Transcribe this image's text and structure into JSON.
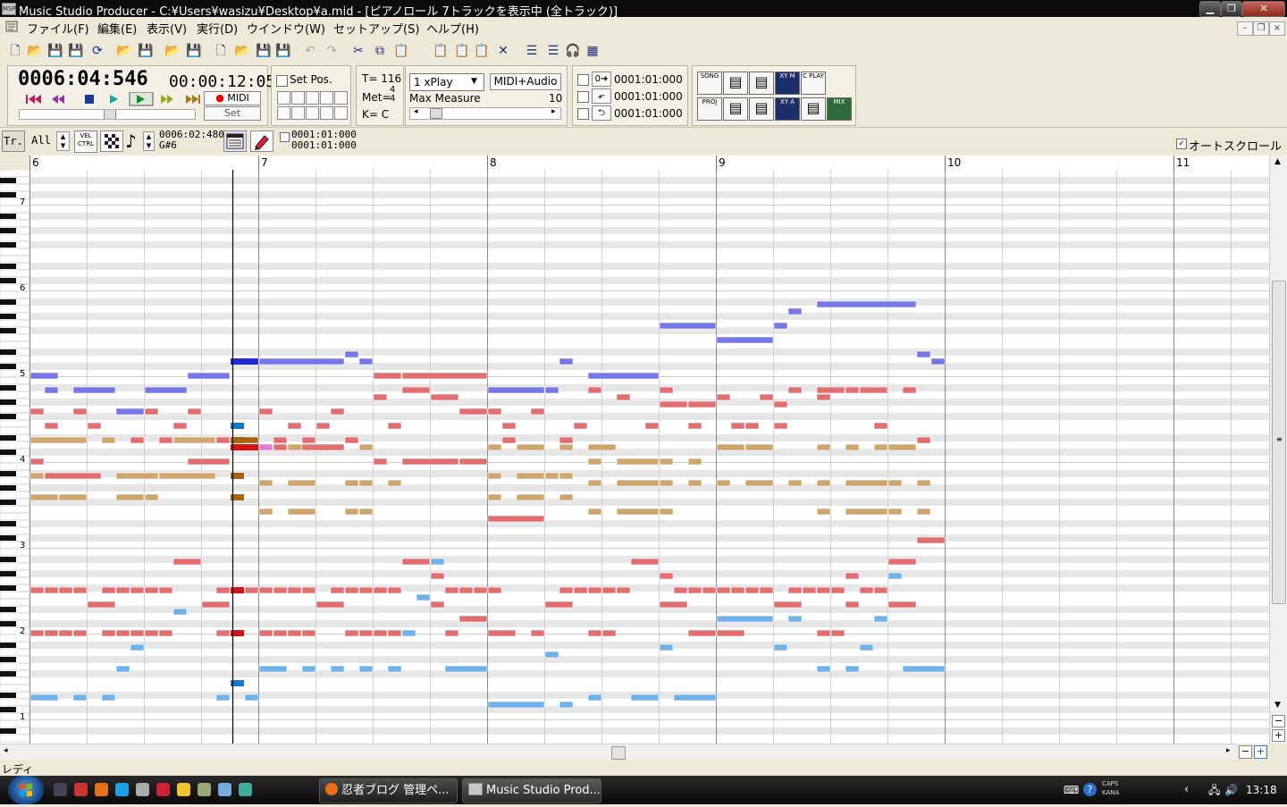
{
  "window": {
    "title": "Music Studio Producer - C:¥Users¥wasizu¥Desktop¥a.mid - [ピアノロール 7トラックを表示中 (全トラック)]",
    "app_icon": "MSP",
    "min_label": "▁",
    "max_label": "❐",
    "close_label": "✕"
  },
  "menu": {
    "items": [
      "ファイル(F)",
      "編集(E)",
      "表示(V)",
      "実行(D)",
      "ウインドウ(W)",
      "セットアップ(S)",
      "ヘルプ(H)"
    ],
    "mdi_min": "–",
    "mdi_restore": "❐",
    "mdi_close": "×"
  },
  "toolbar": {
    "icons": [
      "new-file-icon",
      "open-file-icon",
      "save-icon",
      "save-all-icon",
      "refresh-icon",
      "open-folder-icon",
      "save-disk-icon",
      "open-project-icon",
      "save-project-icon",
      "page-icon",
      "open-icon",
      "save-as-icon",
      "save-smf-icon",
      "undo-icon",
      "redo-icon",
      "cut-icon",
      "copy-icon",
      "paste-icon",
      "paste-insert-icon",
      "paste-merge-icon",
      "paste-replace-icon",
      "delete-icon",
      "list-icon",
      "list-view-icon",
      "headphones-icon",
      "grid-icon"
    ]
  },
  "transport": {
    "measure_pos": "0006:04:546",
    "time": "00:00:12:05",
    "midi_label": "MIDI",
    "set_label": "Set",
    "set_pos_label": "Set Pos.",
    "tempo": "T= 116",
    "meter_label": "Met=",
    "meter_num": "4",
    "meter_den": "4",
    "key": "K=  C",
    "play_mode": "1 xPlay",
    "midi_audio_label": "MIDI+Audio",
    "max_measure_label": "Max Measure",
    "max_measure": "10",
    "loop_positions": [
      "0001:01:000",
      "0001:01:000",
      "0001:01:000"
    ],
    "view_buttons": [
      "SONG",
      "",
      "",
      "XY M",
      "C PLAY",
      "PROJ",
      "",
      "",
      "XY A",
      "",
      "MIX"
    ]
  },
  "pianoroll": {
    "track_btn": "Tr.",
    "track_select": "All",
    "vel_label": "VEL CTRL",
    "cursor_pos": "0006:02:480",
    "cursor_note": "G#6",
    "range_start": "0001:01:000",
    "range_end": "0001:01:000",
    "auto_scroll_label": "オートスクロール",
    "auto_scroll_checked": true,
    "measures": [
      "6",
      "7",
      "8",
      "9",
      "10",
      "11"
    ],
    "octaves": [
      "7",
      "6",
      "5",
      "4",
      "3",
      "2",
      "1"
    ],
    "track_colors": [
      "#7378e4",
      "#e17ad8",
      "#cfa66e",
      "#e26f6f",
      "#6fb3ea"
    ],
    "highlight_colors": [
      "#1f2bd6",
      "#d41414",
      "#a8640f",
      "#cf1fc1",
      "#1478c9"
    ]
  },
  "status": {
    "text": "レディ"
  },
  "taskbar": {
    "tasks": [
      "忍者ブログ 管理ペ...",
      "Music Studio Prod..."
    ],
    "caps": "CAPS",
    "kana": "KANA",
    "clock": "13:18"
  }
}
